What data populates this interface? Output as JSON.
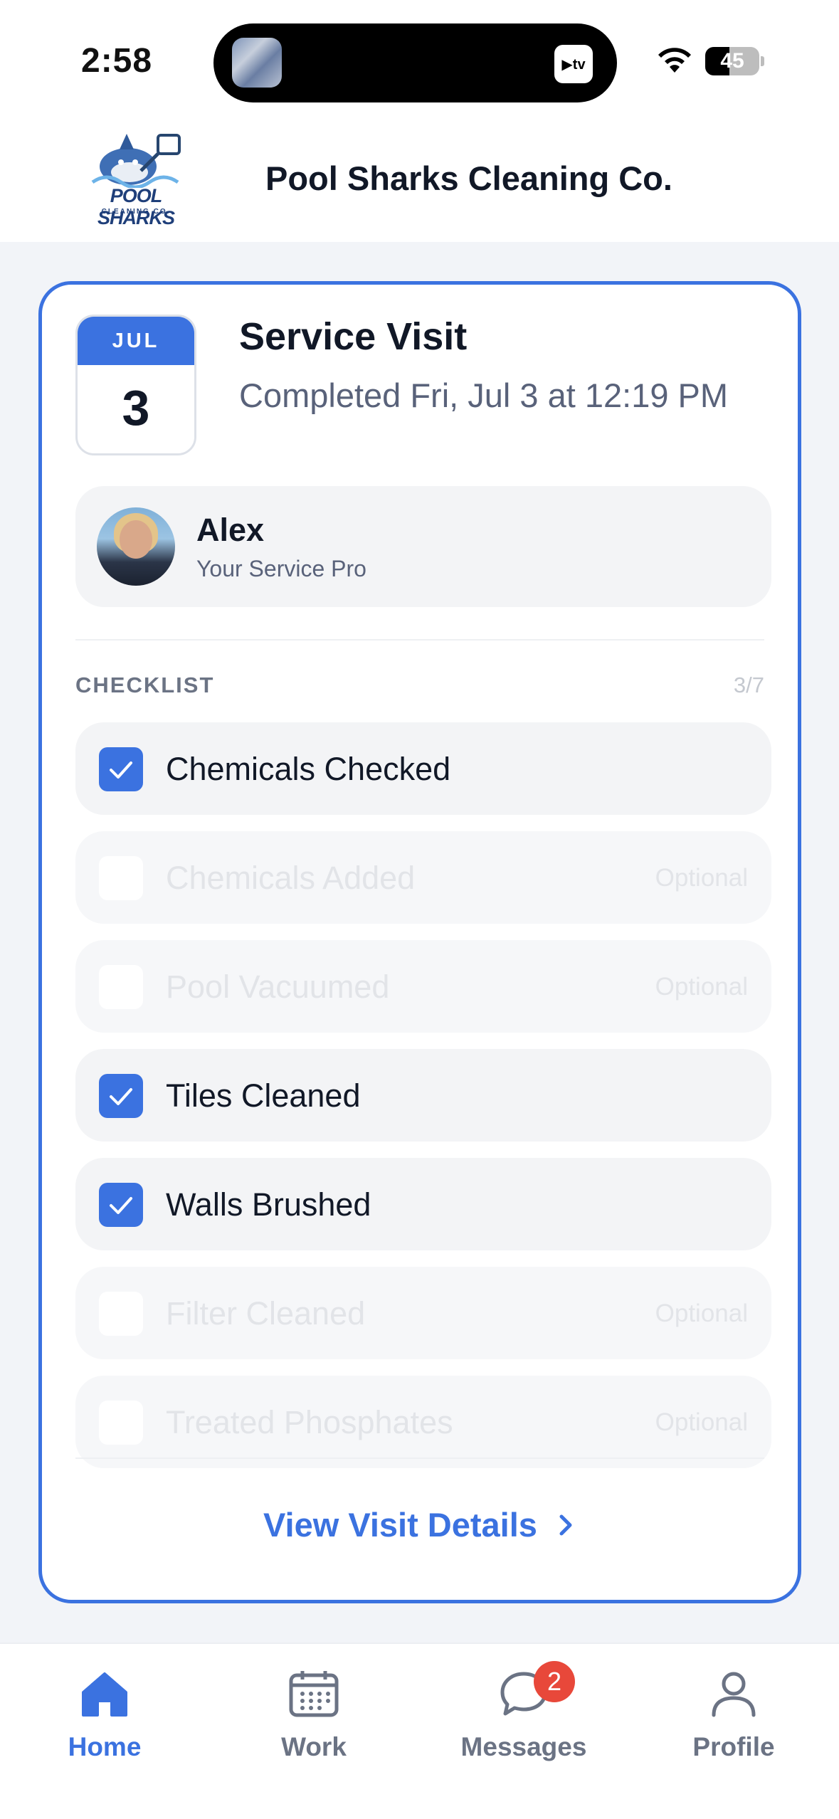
{
  "status_bar": {
    "time": "2:58",
    "battery": "45",
    "battery_level": 0.45
  },
  "header": {
    "logo_text": "POOL SHARKS",
    "logo_sub": "CLEANING CO.",
    "company_name": "Pool Sharks Cleaning Co."
  },
  "visit": {
    "month": "JUL",
    "day": "3",
    "title": "Service Visit",
    "subtitle": "Completed Fri, Jul 3 at 12:19 PM"
  },
  "pro": {
    "name": "Alex",
    "role": "Your Service Pro"
  },
  "checklist": {
    "label": "CHECKLIST",
    "count": "3/7",
    "items": [
      {
        "label": "Chemicals Checked",
        "done": true,
        "tag": ""
      },
      {
        "label": "Chemicals Added",
        "done": false,
        "tag": "Optional"
      },
      {
        "label": "Pool Vacuumed",
        "done": false,
        "tag": "Optional"
      },
      {
        "label": "Tiles Cleaned",
        "done": true,
        "tag": ""
      },
      {
        "label": "Walls Brushed",
        "done": true,
        "tag": ""
      },
      {
        "label": "Filter Cleaned",
        "done": false,
        "tag": "Optional"
      },
      {
        "label": "Treated Phosphates",
        "done": false,
        "tag": "Optional"
      }
    ]
  },
  "view_details": "View Visit Details",
  "tabs": [
    {
      "label": "Home",
      "icon": "home-icon",
      "active": true
    },
    {
      "label": "Work",
      "icon": "calendar-icon",
      "active": false
    },
    {
      "label": "Messages",
      "icon": "chat-icon",
      "active": false,
      "badge": "2"
    },
    {
      "label": "Profile",
      "icon": "person-icon",
      "active": false
    }
  ],
  "colors": {
    "accent": "#3b72e0",
    "badge": "#e8483a"
  }
}
